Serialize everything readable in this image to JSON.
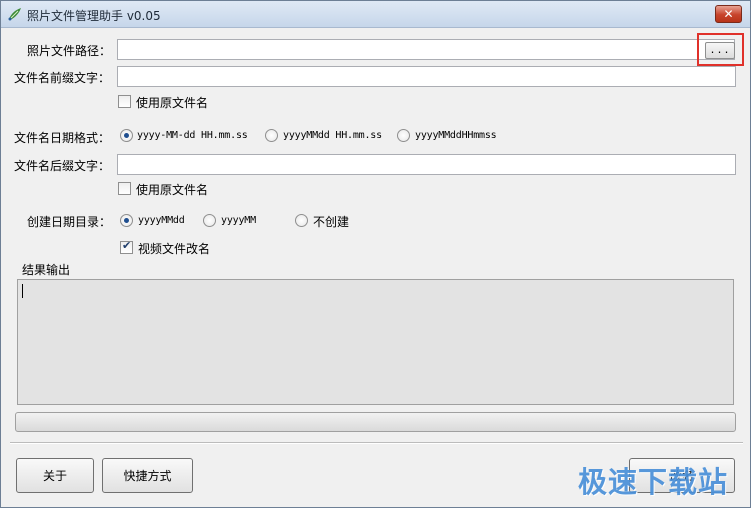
{
  "window": {
    "title": "照片文件管理助手 v0.05",
    "close_label": "✕"
  },
  "form": {
    "photo_path_label": "照片文件路径：",
    "photo_path_value": "",
    "browse_label": "...",
    "prefix_label": "文件名前缀文字：",
    "prefix_value": "",
    "use_original_name_1": {
      "label": "使用原文件名",
      "checked": false
    },
    "date_format_label": "文件名日期格式：",
    "date_format_options": [
      {
        "label": "yyyy-MM-dd HH.mm.ss",
        "checked": true
      },
      {
        "label": "yyyyMMdd HH.mm.ss",
        "checked": false
      },
      {
        "label": "yyyyMMddHHmmss",
        "checked": false
      }
    ],
    "suffix_label": "文件名后缀文字：",
    "suffix_value": "",
    "use_original_name_2": {
      "label": "使用原文件名",
      "checked": false
    },
    "date_dir_label": "创建日期目录：",
    "date_dir_options": [
      {
        "label": "yyyyMMdd",
        "checked": true
      },
      {
        "label": "yyyyMM",
        "checked": false
      },
      {
        "label": "不创建",
        "checked": false
      }
    ],
    "video_rename": {
      "label": "视频文件改名",
      "checked": true
    }
  },
  "output": {
    "section_label": "结果输出",
    "text": ""
  },
  "progress": {
    "value": 0
  },
  "buttons": {
    "about": "关于",
    "shortcut": "快捷方式",
    "rename": "改名"
  },
  "watermark": "极速下载站",
  "colors": {
    "highlight": "#e0312a",
    "watermark": "#4a90d9",
    "close_button": "#c7432b"
  }
}
